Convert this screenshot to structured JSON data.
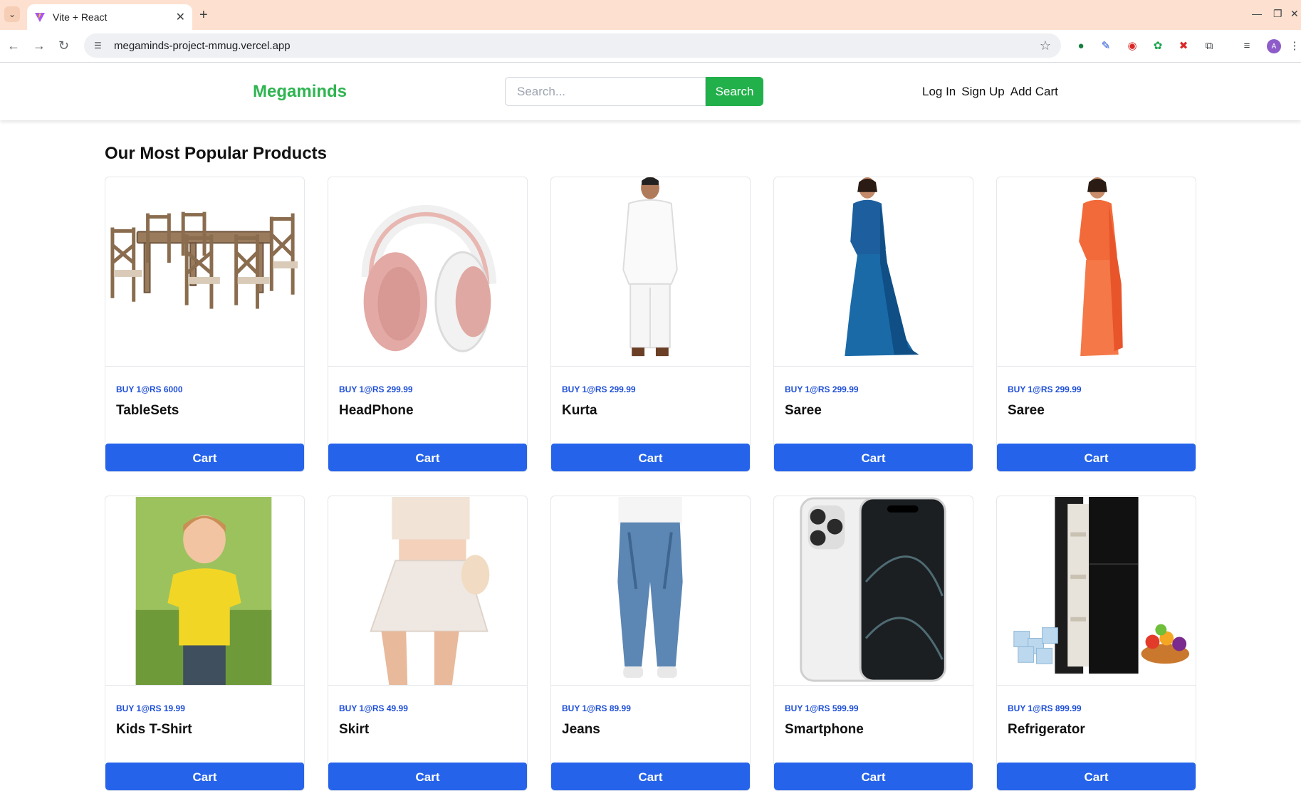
{
  "browser": {
    "tab_title": "Vite + React",
    "url": "megaminds-project-mmug.vercel.app",
    "profile_initial": "A"
  },
  "header": {
    "brand": "Megaminds",
    "search_placeholder": "Search...",
    "search_button": "Search",
    "links": [
      "Log In",
      "Sign Up",
      "Add Cart"
    ]
  },
  "section_title": "Our Most Popular Products",
  "colors": {
    "brand_green": "#2fb450",
    "search_green": "#22b04b",
    "cart_blue": "#2563eb",
    "price_blue": "#1d4ed8"
  },
  "products": [
    {
      "price": "Buy 1@Rs 6000",
      "name": "TableSets",
      "image": "dining-table-set",
      "button": "Cart"
    },
    {
      "price": "Buy 1@Rs 299.99",
      "name": "HeadPhone",
      "image": "pink-headphones",
      "button": "Cart"
    },
    {
      "price": "Buy 1@Rs 299.99",
      "name": "Kurta",
      "image": "white-kurta-man",
      "button": "Cart"
    },
    {
      "price": "Buy 1@Rs 299.99",
      "name": "Saree",
      "image": "blue-saree-woman",
      "button": "Cart"
    },
    {
      "price": "Buy 1@Rs 299.99",
      "name": "Saree",
      "image": "orange-saree-woman",
      "button": "Cart"
    },
    {
      "price": "Buy 1@Rs 19.99",
      "name": "Kids T-Shirt",
      "image": "kid-yellow-tshirt",
      "button": "Cart"
    },
    {
      "price": "Buy 1@Rs 49.99",
      "name": "Skirt",
      "image": "white-skirt",
      "button": "Cart"
    },
    {
      "price": "Buy 1@Rs 89.99",
      "name": "Jeans",
      "image": "blue-jeans",
      "button": "Cart"
    },
    {
      "price": "Buy 1@Rs 599.99",
      "name": "Smartphone",
      "image": "smartphone",
      "button": "Cart"
    },
    {
      "price": "Buy 1@Rs 899.99",
      "name": "Refrigerator",
      "image": "black-refrigerator",
      "button": "Cart"
    }
  ]
}
